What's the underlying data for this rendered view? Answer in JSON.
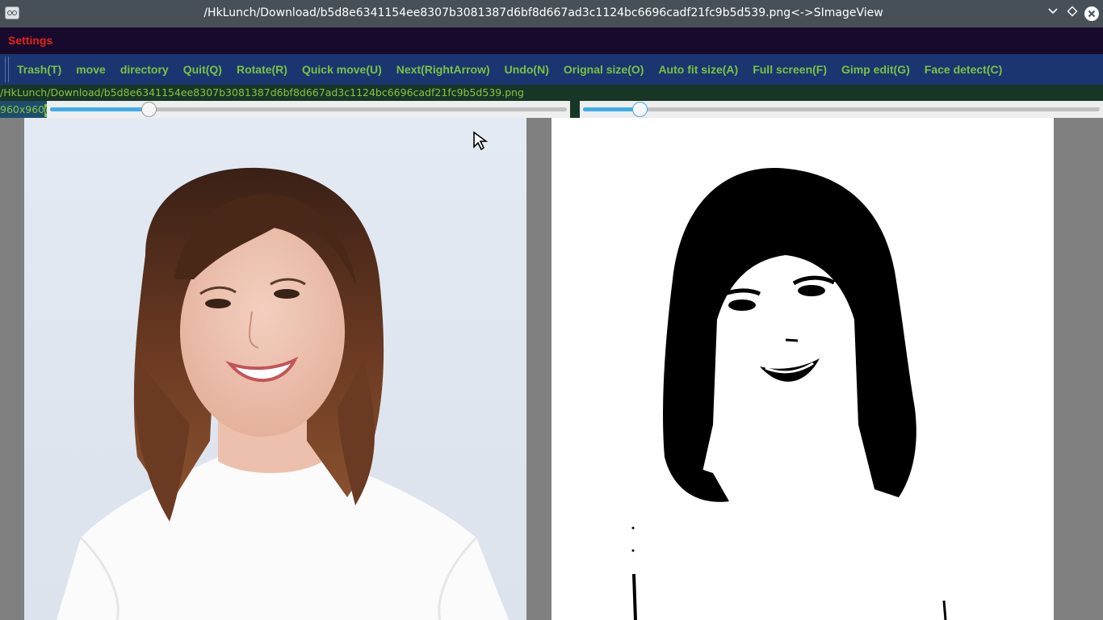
{
  "window": {
    "title": "/HkLunch/Download/b5d8e6341154ee8307b3081387d6bf8d667ad3c1124bc6696cadf21fc9b5d539.png<->SImageView",
    "app_icon": "glasses-icon",
    "controls": {
      "minimize_icon": "chevron-down-icon",
      "maximize_icon": "diamond-icon",
      "close_icon": "close-circle-icon"
    }
  },
  "menu": {
    "settings_label": "Settings"
  },
  "toolbar": {
    "buttons": [
      "Trash(T)",
      "move",
      "directory",
      "Quit(Q)",
      "Rotate(R)",
      "Quick move(U)",
      "Next(RightArrow)",
      "Undo(N)",
      "Orignal size(O)",
      "Auto fit size(A)",
      "Full screen(F)",
      "Gimp edit(G)",
      "Face detect(C)"
    ]
  },
  "path": {
    "text": "/HkLunch/Download/b5d8e6341154ee8307b3081387d6bf8d667ad3c1124bc6696cadf21fc9b5d539.png"
  },
  "image_info": {
    "dimensions": "960x960",
    "cursor_char": "0"
  },
  "sliders": {
    "left_value": 0.19,
    "right_value": 0.11
  },
  "colors": {
    "titlebar": "#475057",
    "menubar": "#180a2c",
    "settings_text": "#e8221a",
    "toolbar": "#1b3570",
    "toolbar_text": "#7cc23f",
    "path_bar": "#183626",
    "slider_accent": "#3daee9",
    "canvas": "#808080"
  },
  "images": {
    "left_alt": "original-photo",
    "right_alt": "black-and-white-threshold"
  }
}
